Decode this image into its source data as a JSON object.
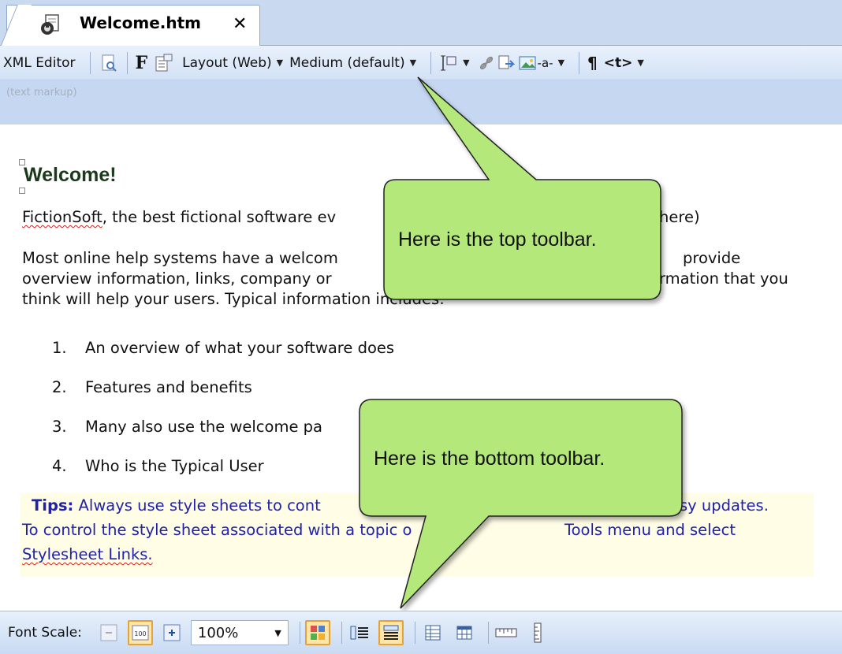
{
  "tab": {
    "title": "Welcome.htm",
    "close": "✕"
  },
  "toolbar_top": {
    "xml_editor": "XML Editor",
    "bold_f": "F",
    "layout": "Layout (Web)",
    "medium": "Medium (default)",
    "minus_a": "-a-",
    "pilcrow": "¶",
    "tag_t": "<t>"
  },
  "subbar": {
    "label": "(text markup)"
  },
  "content": {
    "heading": "Welcome!",
    "p1_a": "FictionSoft",
    "p1_b": ", the best fictional software ev",
    "p1_c": "here)",
    "p2_l1_a": "Most online help systems have a welcom",
    "p2_l1_b": "provide",
    "p2_l2_a": "overview information, links, company or",
    "p2_l2_b": "rmation that you",
    "p2_l3": "think will help your users. Typical information includes:",
    "list": [
      {
        "num": "1.",
        "text": "An overview of what your software does"
      },
      {
        "num": "2.",
        "text": "Features and benefits"
      },
      {
        "num": "3.",
        "text": "Many also use the welcome pa"
      },
      {
        "num": "4.",
        "text": "Who is the Typical User"
      }
    ],
    "tips_label": "Tips:",
    "tips_l1_a": " Always use style sheets to cont",
    "tips_l1_b": "asy updates.",
    "tips_l2_a": "To control the style sheet associated with a topic o",
    "tips_l2_b": "Tools menu and select",
    "tips_l3": "Stylesheet Links."
  },
  "callouts": {
    "top": "Here is the top toolbar.",
    "bottom": "Here is the bottom toolbar."
  },
  "toolbar_bottom": {
    "font_scale_label": "Font Scale:",
    "zoom_value": "100%",
    "btn_100": "100"
  },
  "colors": {
    "callout_fill": "#b4e87a",
    "tips_background": "#fffde6",
    "tips_text": "#1f22a8",
    "toolbar_blue": "#c5d7f1"
  }
}
